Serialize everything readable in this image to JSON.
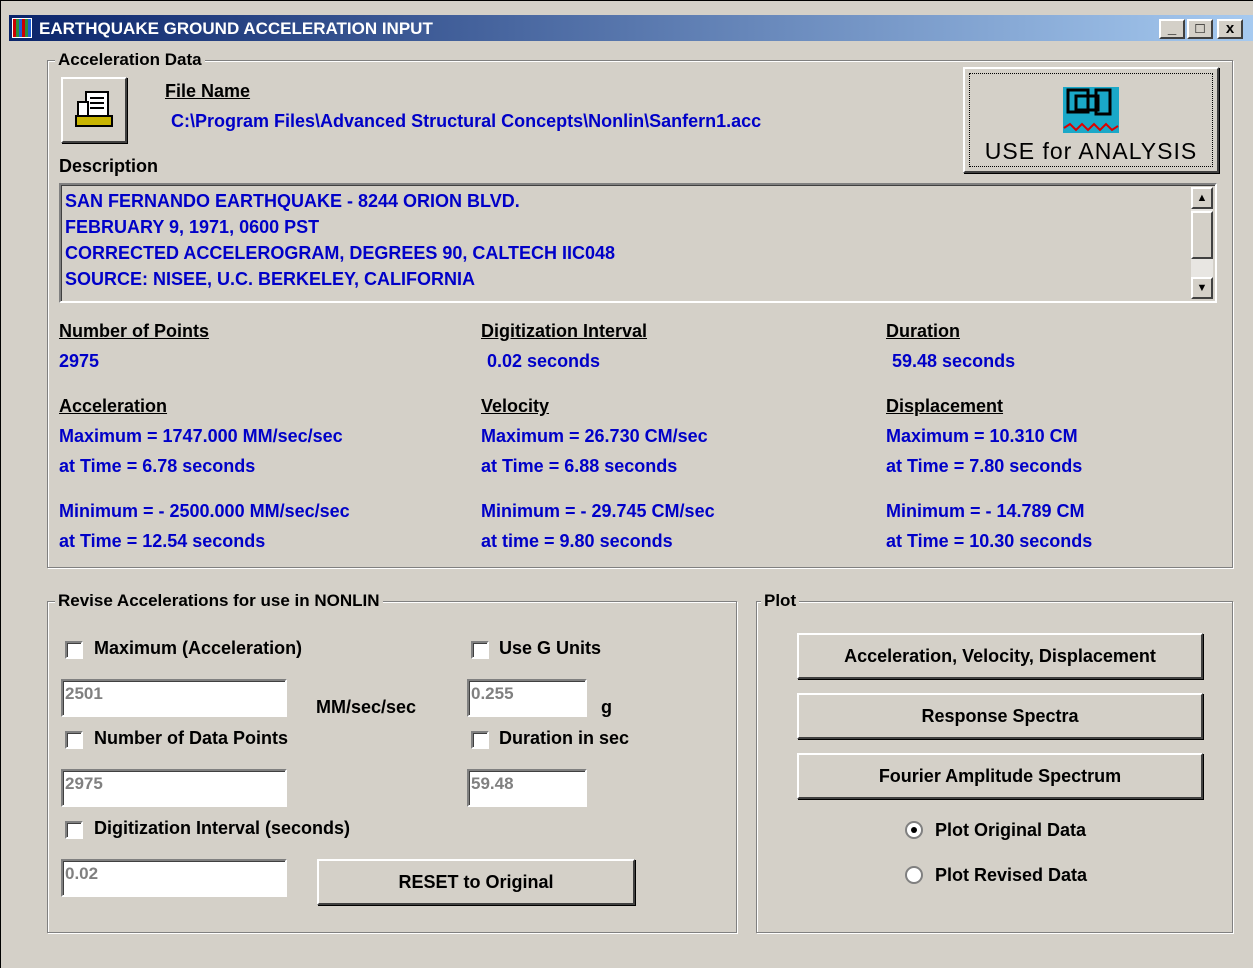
{
  "window": {
    "title": "EARTHQUAKE GROUND ACCELERATION INPUT",
    "min": "_",
    "max": "□",
    "close": "x"
  },
  "accel_data": {
    "group_label": "Acceleration Data",
    "file_name_label": "File Name",
    "file_path": "C:\\Program Files\\Advanced Structural Concepts\\Nonlin\\Sanfern1.acc",
    "description_label": "Description",
    "description_lines": [
      "SAN FERNANDO EARTHQUAKE - 8244 ORION BLVD.",
      "FEBRUARY 9, 1971, 0600 PST",
      "CORRECTED ACCELEROGRAM, DEGREES 90, CALTECH IIC048",
      "SOURCE: NISEE, U.C. BERKELEY, CALIFORNIA"
    ],
    "use_for_analysis": "USE for ANALYSIS",
    "num_points_label": "Number of Points",
    "num_points": "2975",
    "dig_interval_label": "Digitization Interval",
    "dig_interval": "0.02 seconds",
    "duration_label": "Duration",
    "duration": "59.48 seconds",
    "acceleration": {
      "label": "Acceleration",
      "max": "Maximum =  1747.000 MM/sec/sec",
      "max_time": "at Time =  6.78  seconds",
      "min": "Minimum = - 2500.000 MM/sec/sec",
      "min_time": "at Time =  12.54  seconds"
    },
    "velocity": {
      "label": "Velocity",
      "max": "Maximum =  26.730 CM/sec",
      "max_time": "at Time =  6.88  seconds",
      "min": "Minimum = - 29.745 CM/sec",
      "min_time": "at time =  9.80  seconds"
    },
    "displacement": {
      "label": "Displacement",
      "max": "Maximum =  10.310 CM",
      "max_time": "at Time =  7.80  seconds",
      "min": "Minimum = - 14.789 CM",
      "min_time": "at Time =  10.30  seconds"
    }
  },
  "revise": {
    "group_label": "Revise Accelerations for use in NONLIN",
    "max_accel_label": "Maximum (Acceleration)",
    "max_accel_value": "2501",
    "units_label": "MM/sec/sec",
    "g_units_label": "Use G Units",
    "g_value": "0.255",
    "g_label": "g",
    "num_points_label": "Number of Data Points",
    "num_points_value": "2975",
    "duration_label": "Duration in sec",
    "duration_value": "59.48",
    "dig_label": "Digitization Interval (seconds)",
    "dig_value": "0.02",
    "reset_label": "RESET to Original"
  },
  "plot": {
    "group_label": "Plot",
    "avd_button": "Acceleration, Velocity, Displacement",
    "response_button": "Response Spectra",
    "fourier_button": "Fourier Amplitude Spectrum",
    "original_label": "Plot Original Data",
    "revised_label": "Plot Revised Data",
    "selected": "original"
  }
}
